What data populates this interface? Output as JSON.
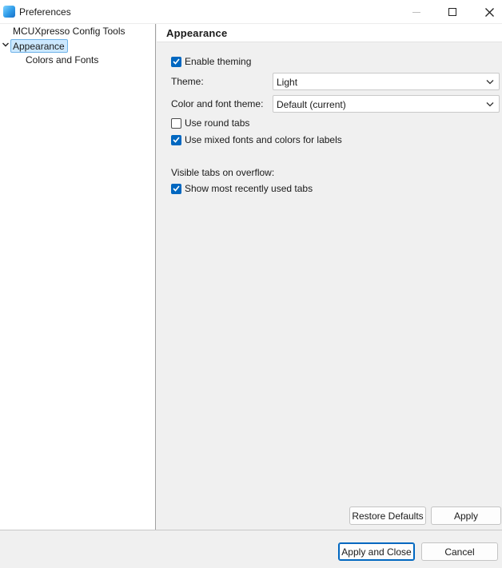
{
  "window": {
    "title": "Preferences",
    "icon": "preferences-app-icon"
  },
  "tree": {
    "root_label": "MCUXpresso Config Tools",
    "selected_label": "Appearance",
    "child_label": "Colors and Fonts"
  },
  "page": {
    "title": "Appearance",
    "enable_theming": {
      "label": "Enable theming",
      "checked": true
    },
    "theme": {
      "label": "Theme:",
      "value": "Light"
    },
    "color_font_theme": {
      "label": "Color and font theme:",
      "value": "Default (current)"
    },
    "round_tabs": {
      "label": "Use round tabs",
      "checked": false
    },
    "mixed_fonts": {
      "label": "Use mixed fonts and colors for labels",
      "checked": true
    },
    "overflow_section_label": "Visible tabs on overflow:",
    "mru_tabs": {
      "label": "Show most recently used tabs",
      "checked": true
    }
  },
  "buttons": {
    "restore_defaults": "Restore Defaults",
    "apply": "Apply",
    "apply_and_close": "Apply and Close",
    "cancel": "Cancel"
  },
  "colors": {
    "accent": "#0067c0",
    "selection_bg": "#cce8ff",
    "panel_bg": "#f0f0f0"
  }
}
